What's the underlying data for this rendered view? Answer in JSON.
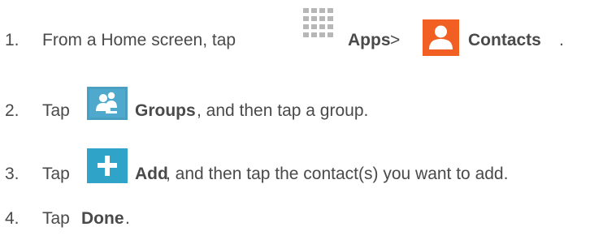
{
  "steps": [
    {
      "number": "1.",
      "parts": {
        "a": "From a Home screen, tap ",
        "b": "Apps",
        "c": " > ",
        "d": "Contacts",
        "e": "."
      },
      "icons": [
        "apps-grid-icon",
        "contacts-person-icon"
      ]
    },
    {
      "number": "2.",
      "parts": {
        "a": "Tap ",
        "b": "Groups",
        "c": ", and then tap a group."
      },
      "icons": [
        "groups-icon"
      ]
    },
    {
      "number": "3.",
      "parts": {
        "a": "Tap ",
        "b": "Add",
        "c": ", and then tap the contact(s) you want to add."
      },
      "icons": [
        "add-plus-icon"
      ]
    },
    {
      "number": "4.",
      "parts": {
        "a": "Tap ",
        "b": "Done",
        "c": "."
      }
    }
  ],
  "colors": {
    "text": "#4a4a4a",
    "apps_grid": "#b7b7b7",
    "contacts_icon": "#f16022",
    "groups_icon": "#4a9fc0",
    "add_icon": "#2fa3c8"
  }
}
